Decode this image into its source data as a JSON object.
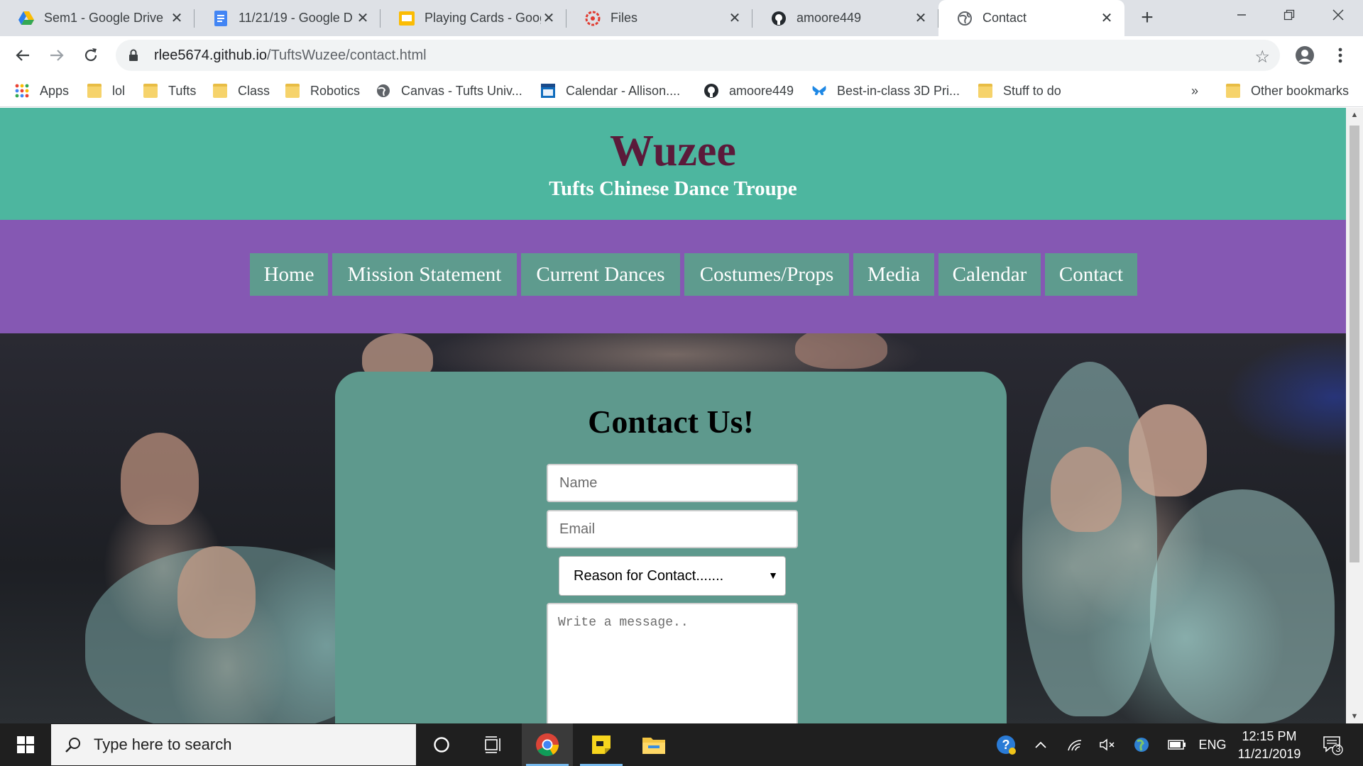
{
  "browser": {
    "tabs": [
      {
        "title": "Sem1 - Google Drive",
        "icon": "google-drive-icon"
      },
      {
        "title": "11/21/19 - Google D",
        "icon": "google-docs-icon"
      },
      {
        "title": "Playing Cards - Goog",
        "icon": "google-slides-icon"
      },
      {
        "title": "Files",
        "icon": "files-icon"
      },
      {
        "title": "amoore449",
        "icon": "github-icon"
      },
      {
        "title": "Contact",
        "icon": "globe-icon",
        "active": true
      }
    ],
    "close_glyph": "✕",
    "new_tab_glyph": "+",
    "url_host": "rlee5674.github.io",
    "url_path": "/TuftsWuzee/contact.html",
    "bookmarks": [
      {
        "label": "Apps",
        "icon": "apps-grid-icon"
      },
      {
        "label": "lol",
        "icon": "folder-icon"
      },
      {
        "label": "Tufts",
        "icon": "folder-icon"
      },
      {
        "label": "Class",
        "icon": "folder-icon"
      },
      {
        "label": "Robotics",
        "icon": "folder-icon"
      },
      {
        "label": "Canvas - Tufts Univ...",
        "icon": "globe-icon"
      },
      {
        "label": "Calendar - Allison....",
        "icon": "calendar-icon"
      },
      {
        "label": "amoore449",
        "icon": "github-icon"
      },
      {
        "label": "Best-in-class 3D Pri...",
        "icon": "butterfly-icon"
      },
      {
        "label": "Stuff to do",
        "icon": "folder-icon"
      }
    ],
    "overflow": "»",
    "other_bookmarks": "Other bookmarks"
  },
  "site": {
    "name": "Wuzee",
    "tagline": "Tufts Chinese Dance Troupe",
    "nav": [
      "Home",
      "Mission Statement",
      "Current Dances",
      "Costumes/Props",
      "Media",
      "Calendar",
      "Contact"
    ]
  },
  "contact_form": {
    "title": "Contact Us!",
    "name_placeholder": "Name",
    "email_placeholder": "Email",
    "reason_selected": "Reason for Contact.......",
    "message_placeholder": "Write a message.."
  },
  "taskbar": {
    "search_placeholder": "Type here to search",
    "language": "ENG",
    "time": "12:15 PM",
    "date": "11/21/2019",
    "notification_count": "3"
  },
  "colors": {
    "header_teal": "#4db69f",
    "nav_purple": "#8558b3",
    "nav_button": "#5e9b8e",
    "logo_maroon": "#5b1a3a",
    "card_teal": "#5e998d"
  }
}
